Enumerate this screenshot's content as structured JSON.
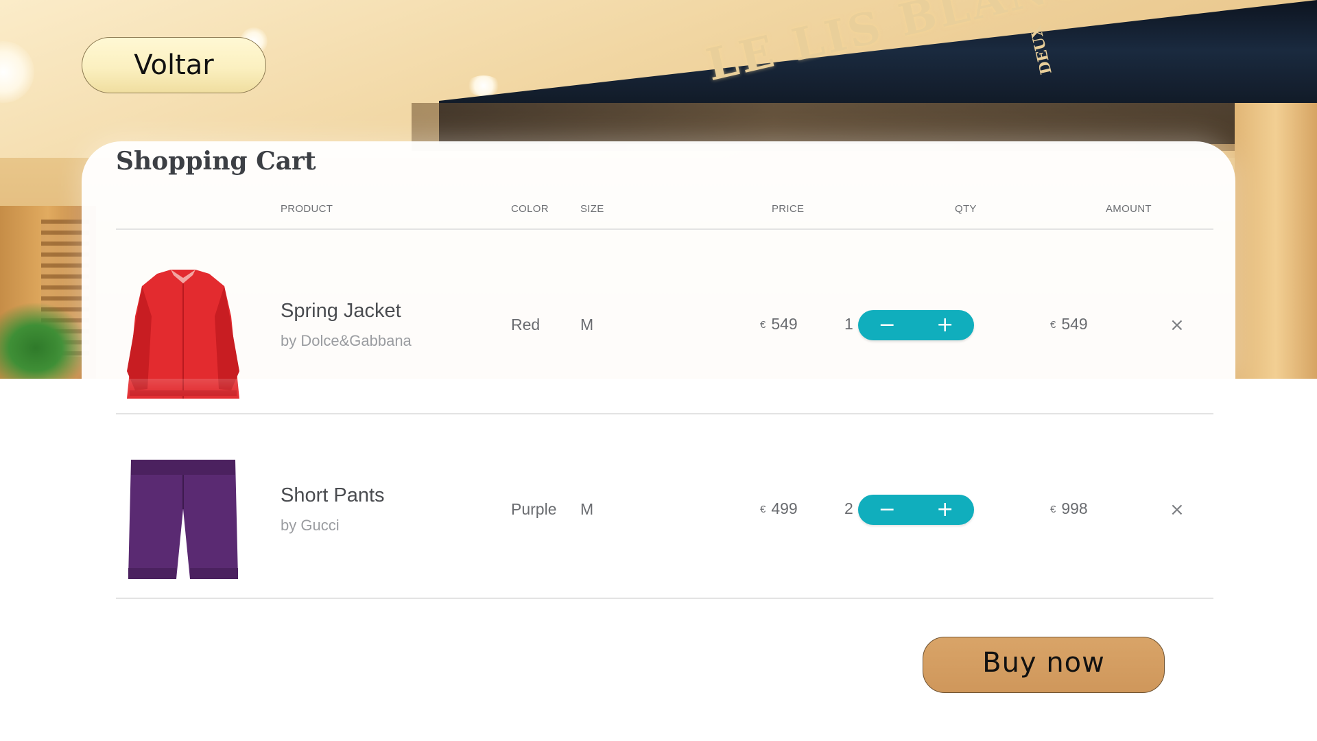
{
  "nav": {
    "back_label": "Voltar"
  },
  "store": {
    "sign_main": "LE LIS BLANC",
    "sign_sub": "DEUX"
  },
  "cart": {
    "title": "Shopping Cart",
    "columns": {
      "product": "PRODUCT",
      "color": "COLOR",
      "size": "SIZE",
      "price": "PRICE",
      "qty": "QTY",
      "amount": "AMOUNT"
    },
    "currency_symbol": "€",
    "items": [
      {
        "name": "Spring Jacket",
        "brand": "by Dolce&Gabbana",
        "color": "Red",
        "size": "M",
        "price": "549",
        "qty": "1",
        "amount": "549",
        "image": "red-jacket-image",
        "swatch": "#e32b2f"
      },
      {
        "name": "Short Pants",
        "brand": "by Gucci",
        "color": "Purple",
        "size": "M",
        "price": "499",
        "qty": "2",
        "amount": "998",
        "image": "purple-shorts-image",
        "swatch": "#5a2a72"
      }
    ],
    "stepper": {
      "decrement_symbol": "−",
      "increment_symbol": "+",
      "color": "#10aebd"
    },
    "remove_symbol": "×"
  },
  "checkout": {
    "buy_label": "Buy now",
    "color": "#d59e62"
  }
}
